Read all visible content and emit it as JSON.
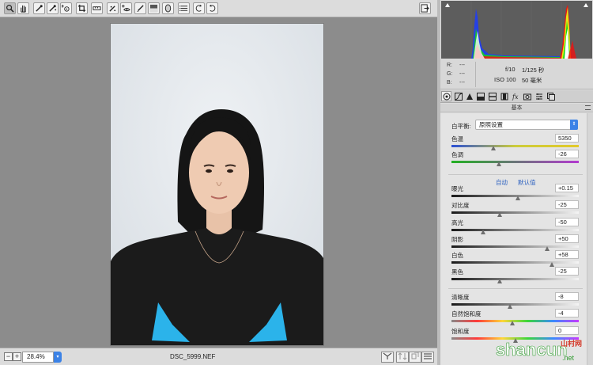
{
  "toolbar": {
    "tools": [
      "zoom-tool",
      "hand-tool",
      "white-balance-tool",
      "color-sampler-tool",
      "targeted-adjustment-tool",
      "crop-tool",
      "straighten-tool",
      "spot-removal-tool",
      "red-eye-removal-tool",
      "adjustment-brush-tool",
      "graduated-filter-tool",
      "radial-filter-tool",
      "preferences-tool",
      "rotate-left-tool",
      "rotate-right-tool"
    ],
    "active_tool": "zoom-tool"
  },
  "status": {
    "zoom": "28.4%",
    "filename": "DSC_5999.NEF"
  },
  "info": {
    "r_label": "R:",
    "r_value": "---",
    "g_label": "G:",
    "g_value": "---",
    "b_label": "B:",
    "b_value": "---",
    "aperture": "f/10",
    "shutter": "1/125 秒",
    "iso": "ISO 100",
    "focal": "50 毫米"
  },
  "panel": {
    "section_title": "基本",
    "white_balance_label": "白平衡:",
    "white_balance_value": "原照设置",
    "auto_label": "自动",
    "default_label": "默认值",
    "sliders": [
      {
        "label": "色温",
        "value": "5350",
        "position": 0.33,
        "track": "temp"
      },
      {
        "label": "色调",
        "value": "-26",
        "position": 0.37,
        "track": "tint"
      },
      {
        "label": "曝光",
        "value": "+0.15",
        "position": 0.52,
        "track": "gray"
      },
      {
        "label": "对比度",
        "value": "-25",
        "position": 0.38,
        "track": "gray"
      },
      {
        "label": "高光",
        "value": "-50",
        "position": 0.25,
        "track": "gray"
      },
      {
        "label": "阴影",
        "value": "+50",
        "position": 0.75,
        "track": "gray"
      },
      {
        "label": "白色",
        "value": "+58",
        "position": 0.79,
        "track": "gray"
      },
      {
        "label": "黑色",
        "value": "-25",
        "position": 0.38,
        "track": "gray"
      },
      {
        "label": "清晰度",
        "value": "-8",
        "position": 0.46,
        "track": "gray"
      },
      {
        "label": "自然饱和度",
        "value": "-4",
        "position": 0.48,
        "track": "sat"
      },
      {
        "label": "饱和度",
        "value": "0",
        "position": 0.5,
        "track": "sat"
      }
    ]
  },
  "watermark": {
    "text": "shancun",
    "sub": "山村网",
    "domain": ".net"
  },
  "colors": {
    "accent": "#3b82e6",
    "panel_bg": "#e4e4e4",
    "canvas_bg": "#8c8c8c",
    "shirt": "#1b1b1b",
    "eyes": "#2bb3ea"
  }
}
